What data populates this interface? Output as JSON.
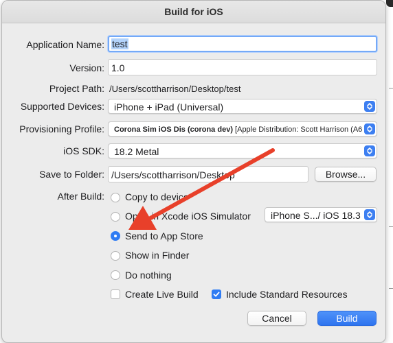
{
  "window": {
    "title": "Build for iOS"
  },
  "labels": {
    "app_name": "Application Name:",
    "version": "Version:",
    "project_path": "Project Path:",
    "supported_devices": "Supported Devices:",
    "provisioning_profile": "Provisioning Profile:",
    "ios_sdk": "iOS SDK:",
    "save_to_folder": "Save to Folder:",
    "after_build": "After Build:"
  },
  "fields": {
    "app_name": "test",
    "version": "1.0",
    "project_path": "/Users/scottharrison/Desktop/test",
    "save_folder": "/Users/scottharrison/Desktop"
  },
  "popups": {
    "supported_devices": "iPhone + iPad (Universal)",
    "provisioning_bold": "Corona Sim iOS Dis (corona dev)",
    "provisioning_rest": "[Apple Distribution: Scott Harrison (A6",
    "ios_sdk": "18.2 Metal",
    "simulator": "iPhone S.../ iOS 18.3"
  },
  "buttons": {
    "browse": "Browse...",
    "cancel": "Cancel",
    "build": "Build"
  },
  "after_build": {
    "options": [
      {
        "label": "Copy to device",
        "selected": false
      },
      {
        "label": "Open in Xcode iOS Simulator",
        "selected": false
      },
      {
        "label": "Send to App Store",
        "selected": true
      },
      {
        "label": "Show in Finder",
        "selected": false
      },
      {
        "label": "Do nothing",
        "selected": false
      }
    ]
  },
  "checkboxes": {
    "live_build": {
      "label": "Create Live Build",
      "checked": false
    },
    "standard_resources": {
      "label": "Include Standard Resources",
      "checked": true
    }
  },
  "icons": {
    "popup": "chevron-updown-icon",
    "check": "checkmark-icon",
    "annotation": "red-arrow-icon"
  },
  "colors": {
    "accent": "#2f7cf3",
    "annotation": "#e8402a"
  }
}
